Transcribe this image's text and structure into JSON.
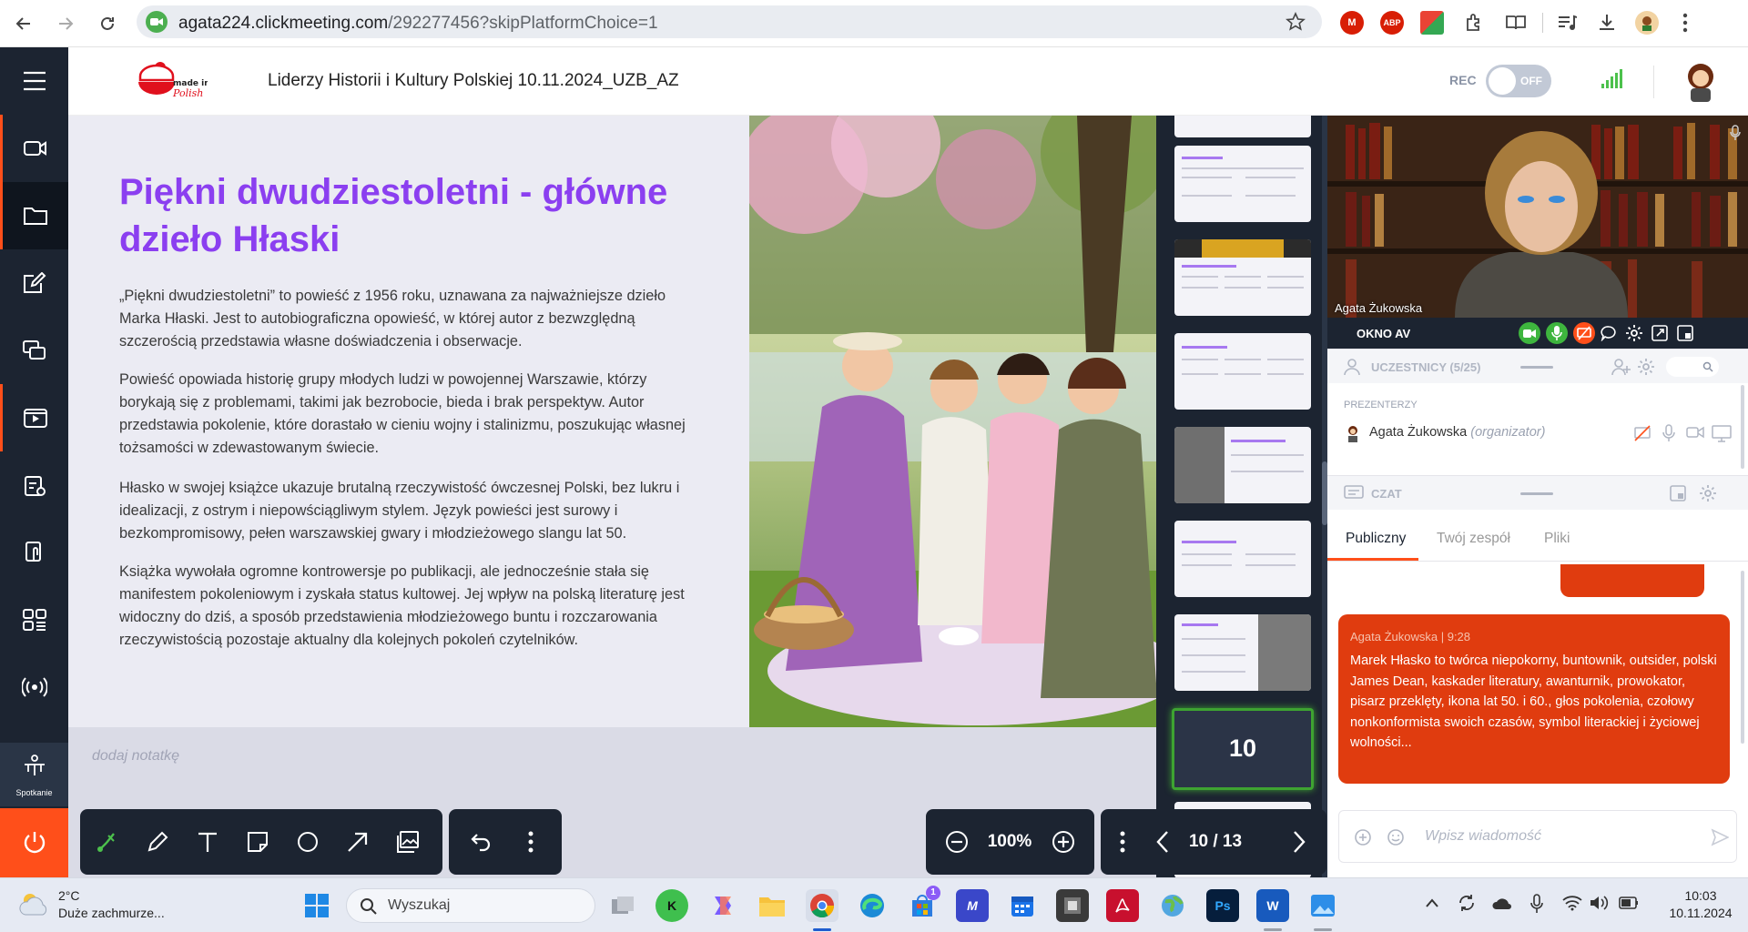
{
  "browser": {
    "url_host": "agata224.clickmeeting.com",
    "url_path": "/292277456?skipPlatformChoice=1"
  },
  "header": {
    "logo_text": "made in Polish",
    "title": "Liderzy Historii i Kultury Polskiej 10.11.2024_UZB_AZ",
    "rec_label": "REC",
    "rec_toggle": "OFF"
  },
  "sidebar": {
    "meeting_label": "Spotkanie"
  },
  "slide": {
    "title": "Piękni dwudziestoletni - główne dzieło Hłaski",
    "paragraphs": [
      "„Piękni dwudziestoletni” to powieść z 1956 roku, uznawana za najważniejsze dzieło Marka Hłaski. Jest to autobiograficzna opowieść, w której autor z bezwzględną szczerością przedstawia własne doświadczenia i obserwacje.",
      "Powieść opowiada historię grupy młodych ludzi w powojennej Warszawie, którzy borykają się z problemami, takimi jak bezrobocie, bieda i brak perspektyw. Autor przedstawia pokolenie, które dorastało w cieniu wojny i stalinizmu, poszukując własnej tożsamości w zdewastowanym świecie.",
      "Hłasko w swojej książce ukazuje brutalną rzeczywistość ówczesnej Polski, bez lukru i idealizacji, z ostrym i niepowściągliwym stylem. Język powieści jest surowy i bezkompromisowy, pełen warszawskiej gwary i młodzieżowego slangu lat 50.",
      "Książka wywołała ogromne kontrowersje po publikacji, ale jednocześnie stała się manifestem pokoleniowym i zyskała status kultowej. Jej wpływ na polską literaturę jest widoczny do dziś, a sposób przedstawienia młodzieżowego buntu i rozczarowania rzeczywistością pozostaje aktualny dla kolejnych pokoleń czytelników."
    ]
  },
  "notes": {
    "placeholder": "dodaj notatkę"
  },
  "thumbnails": {
    "current_number": "10"
  },
  "toolbar": {
    "zoom": "100%",
    "page": "10 / 13"
  },
  "video": {
    "name": "Agata Żukowska"
  },
  "av_window": {
    "label": "OKNO AV"
  },
  "participants": {
    "header": "UCZESTNICY (5/25)",
    "presenters_label": "PREZENTERZY",
    "presenter_name": "Agata Żukowska",
    "presenter_role": "(organizator)"
  },
  "chat": {
    "header": "CZAT",
    "tabs": [
      "Publiczny",
      "Twój zespół",
      "Pliki"
    ],
    "message": {
      "author": "Agata Żukowska",
      "time": "9:28",
      "text": "Marek Hłasko to twórca niepokorny, buntownik, outsider, polski James Dean, kaskader literatury, awanturnik, prowokator, pisarz przeklęty, ikona lat 50. i 60., głos pokolenia, czołowy nonkonformista swoich czasów, symbol literackiej i życiowej wolności..."
    },
    "input_placeholder": "Wpisz wiadomość"
  },
  "taskbar": {
    "weather_temp": "2°C",
    "weather_desc": "Duże zachmurze...",
    "search_placeholder": "Wyszukaj",
    "time": "10:03",
    "date": "10.11.2024",
    "badge": "1"
  },
  "colors": {
    "accent": "#ff4f1a",
    "title_purple": "#8b3ff0",
    "sidebar": "#1c2431",
    "chat_bubble": "#e03c0f"
  }
}
